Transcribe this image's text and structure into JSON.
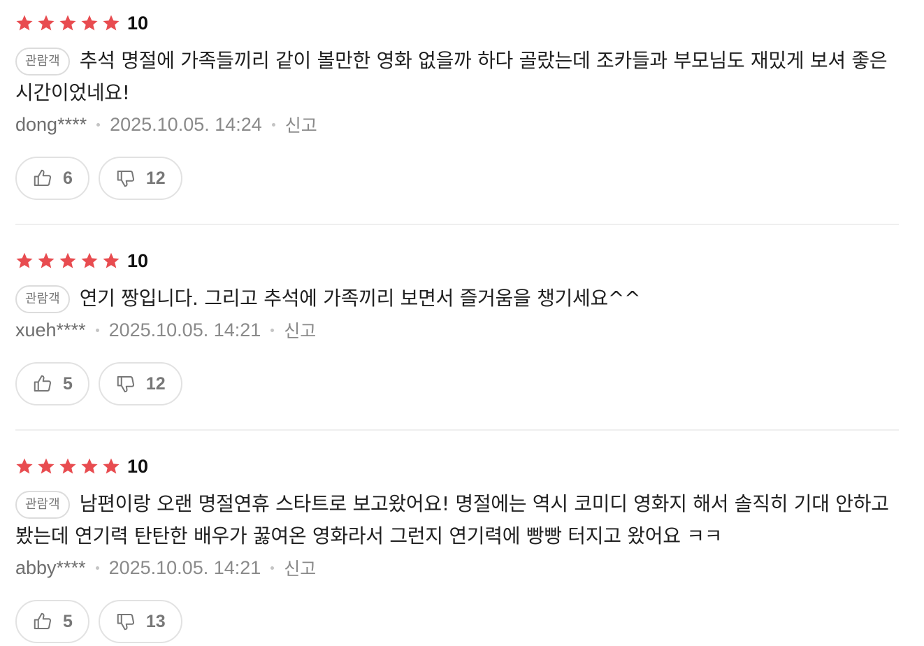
{
  "colors": {
    "star": "#e84c50",
    "divider": "#efefef",
    "muted_text": "#8a8a8a"
  },
  "reviews": [
    {
      "stars": 5,
      "score": "10",
      "badge": "관람객",
      "text": "추석 명절에 가족들끼리 같이 볼만한 영화 없을까 하다 골랐는데 조카들과 부모님도 재밌게 보셔 좋은 시간이었네요!",
      "author": "dong****",
      "date": "2025.10.05. 14:24",
      "report_label": "신고",
      "likes": "6",
      "dislikes": "12"
    },
    {
      "stars": 5,
      "score": "10",
      "badge": "관람객",
      "text": "연기 짱입니다. 그리고 추석에 가족끼리 보면서 즐거움을 챙기세요^^",
      "author": "xueh****",
      "date": "2025.10.05. 14:21",
      "report_label": "신고",
      "likes": "5",
      "dislikes": "12"
    },
    {
      "stars": 5,
      "score": "10",
      "badge": "관람객",
      "text": "남편이랑 오랜 명절연휴 스타트로 보고왔어요! 명절에는 역시 코미디 영화지 해서 솔직히 기대 안하고 봤는데 연기력 탄탄한 배우가 꿇여온 영화라서 그런지 연기력에 빵빵 터지고 왔어요 ㅋㅋ",
      "author": "abby****",
      "date": "2025.10.05. 14:21",
      "report_label": "신고",
      "likes": "5",
      "dislikes": "13"
    }
  ]
}
